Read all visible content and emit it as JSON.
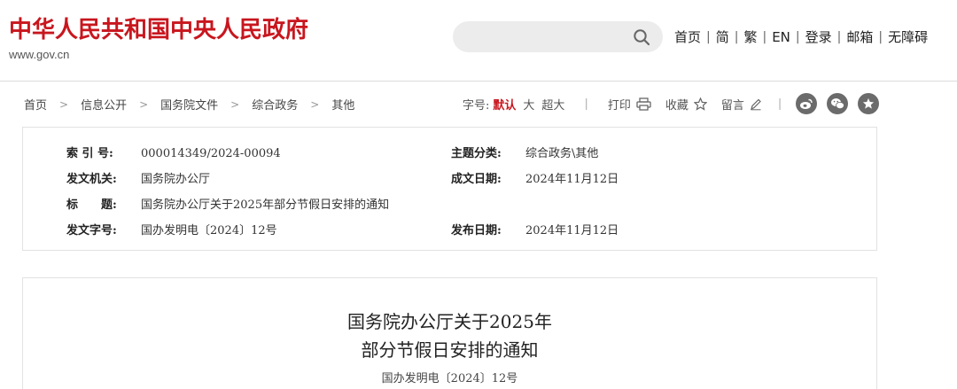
{
  "header": {
    "site_title": "中华人民共和国中央人民政府",
    "site_url": "www.gov.cn",
    "search": {
      "placeholder": ""
    },
    "nav": [
      "首页",
      "简",
      "繁",
      "EN",
      "登录",
      "邮箱",
      "无障碍"
    ],
    "nav_separator": "|",
    "brand_color": "#c8161e"
  },
  "breadcrumb": {
    "items": [
      "首页",
      "信息公开",
      "国务院文件",
      "综合政务",
      "其他"
    ],
    "separator": ">"
  },
  "tools": {
    "font_size_label": "字号:",
    "font_sizes": [
      "默认",
      "大",
      "超大"
    ],
    "active_font_size": "默认",
    "print_label": "打印",
    "favorite_label": "收藏",
    "comment_label": "留言",
    "separator": "|"
  },
  "share": [
    "weibo-icon",
    "wechat-icon",
    "qzone-icon"
  ],
  "meta": {
    "index_no_label": "索 引 号:",
    "index_no": "000014349/2024-00094",
    "topic_label": "主题分类:",
    "topic": "综合政务\\其他",
    "issuer_label": "发文机关:",
    "issuer": "国务院办公厅",
    "created_label": "成文日期:",
    "created": "2024年11月12日",
    "title_label": "标　　题:",
    "title": "国务院办公厅关于2025年部分节假日安排的通知",
    "doc_no_label": "发文字号:",
    "doc_no": "国办发明电〔2024〕12号",
    "published_label": "发布日期:",
    "published": "2024年11月12日"
  },
  "article": {
    "title_line1": "国务院办公厅关于2025年",
    "title_line2": "部分节假日安排的通知",
    "doc_no": "国办发明电〔2024〕12号"
  }
}
